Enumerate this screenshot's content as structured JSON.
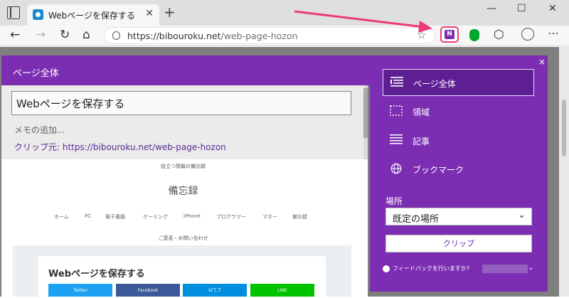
{
  "browser": {
    "tab_title": "Webページを保存する",
    "tab_close": "✕",
    "new_tab": "+",
    "win_min": "—",
    "win_max": "☐",
    "win_close": "✕",
    "url_host": "https://bibouroku.net",
    "url_path": "/web-page-hozon",
    "nav_back": "←",
    "nav_forward": "→",
    "nav_reload": "↻",
    "nav_home": "⌂",
    "more": "⋯"
  },
  "clipper": {
    "header_title": "ページ全体",
    "title_value": "Webページを保存する",
    "memo_placeholder": "メモの追加...",
    "source": "クリップ元: https://bibouroku.net/web-page-hozon"
  },
  "preview": {
    "tagline": "役立つ情報の備忘録",
    "site_title": "備忘録",
    "nav": [
      "ホーム",
      "PC",
      "電子書籍",
      "ゲーミング",
      "iPhone",
      "プログラマー",
      "マネー",
      "備忘録"
    ],
    "contact": "ご意見・お問い合わせ",
    "card_title": "Webページを保存する",
    "share": [
      {
        "label": "Twitter",
        "color": "#1da1f2"
      },
      {
        "label": "Facebook",
        "color": "#3b5998"
      },
      {
        "label": "はてブ",
        "color": "#008fde"
      },
      {
        "label": "LINE",
        "color": "#00c300"
      }
    ]
  },
  "panel": {
    "close": "×",
    "options": [
      "ページ全体",
      "領域",
      "記事",
      "ブックマーク"
    ],
    "location_label": "場所",
    "location_value": "既定の場所",
    "location_chevron": "⌄",
    "clip_button": "クリップ",
    "feedback": "フィードバックを行いますか?",
    "user_chevron": "⌄"
  },
  "colors": {
    "onenote_purple": "#7c2eb3",
    "highlight": "#ec3b77"
  }
}
